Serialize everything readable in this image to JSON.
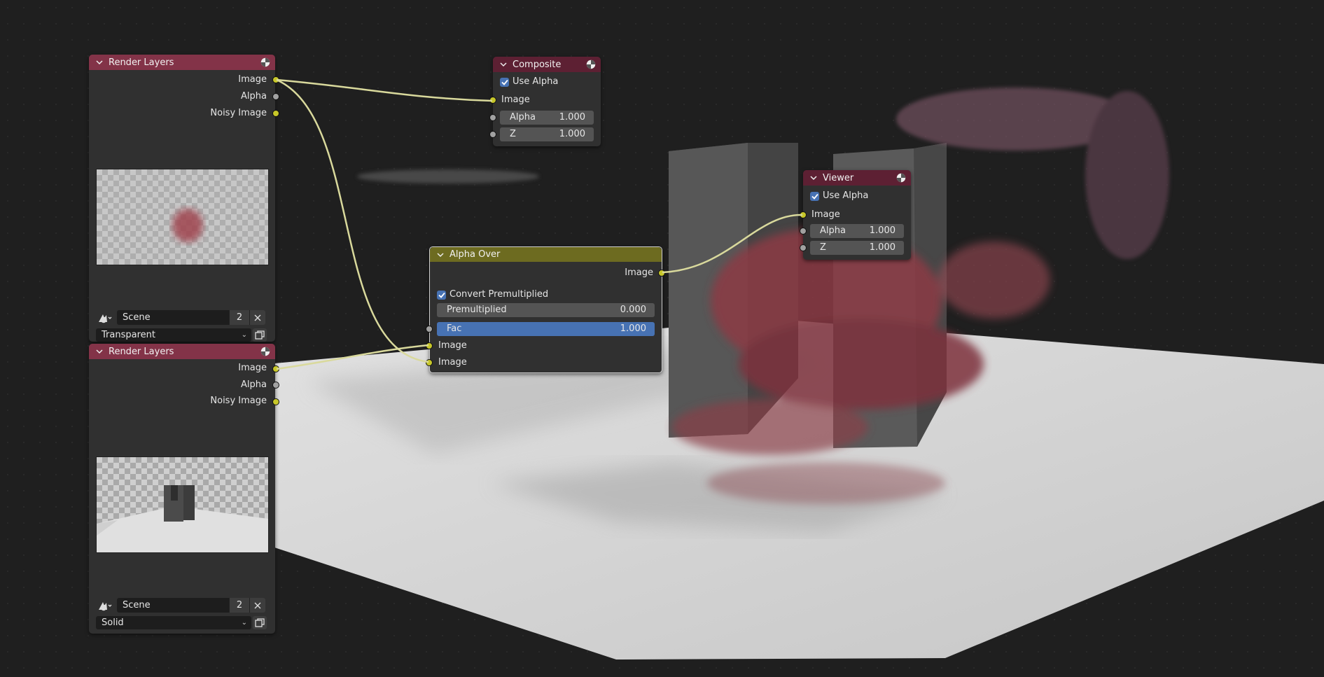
{
  "colors": {
    "socket_color": "#c7c729",
    "render_layers_header": "#833348",
    "alpha_over_header": "#6d6b20",
    "output_header": "#5d2033",
    "active_field": "#4772b3"
  },
  "render_layers_1": {
    "title": "Render Layers",
    "outputs": {
      "image": "Image",
      "alpha": "Alpha",
      "noisy_image": "Noisy Image"
    },
    "scene": "Scene",
    "scene_users": "2",
    "pass": "Transparent"
  },
  "render_layers_2": {
    "title": "Render Layers",
    "outputs": {
      "image": "Image",
      "alpha": "Alpha",
      "noisy_image": "Noisy Image"
    },
    "scene": "Scene",
    "scene_users": "2",
    "pass": "Solid"
  },
  "composite": {
    "title": "Composite",
    "use_alpha_label": "Use Alpha",
    "input_image": "Image",
    "alpha_label": "Alpha",
    "alpha_value": "1.000",
    "z_label": "Z",
    "z_value": "1.000"
  },
  "viewer": {
    "title": "Viewer",
    "use_alpha_label": "Use Alpha",
    "input_image": "Image",
    "alpha_label": "Alpha",
    "alpha_value": "1.000",
    "z_label": "Z",
    "z_value": "1.000"
  },
  "alpha_over": {
    "title": "Alpha Over",
    "output_image": "Image",
    "convert_premultiplied_label": "Convert Premultiplied",
    "premultiplied_label": "Premultiplied",
    "premultiplied_value": "0.000",
    "fac_label": "Fac",
    "fac_value": "1.000",
    "input_image_1": "Image",
    "input_image_2": "Image"
  }
}
